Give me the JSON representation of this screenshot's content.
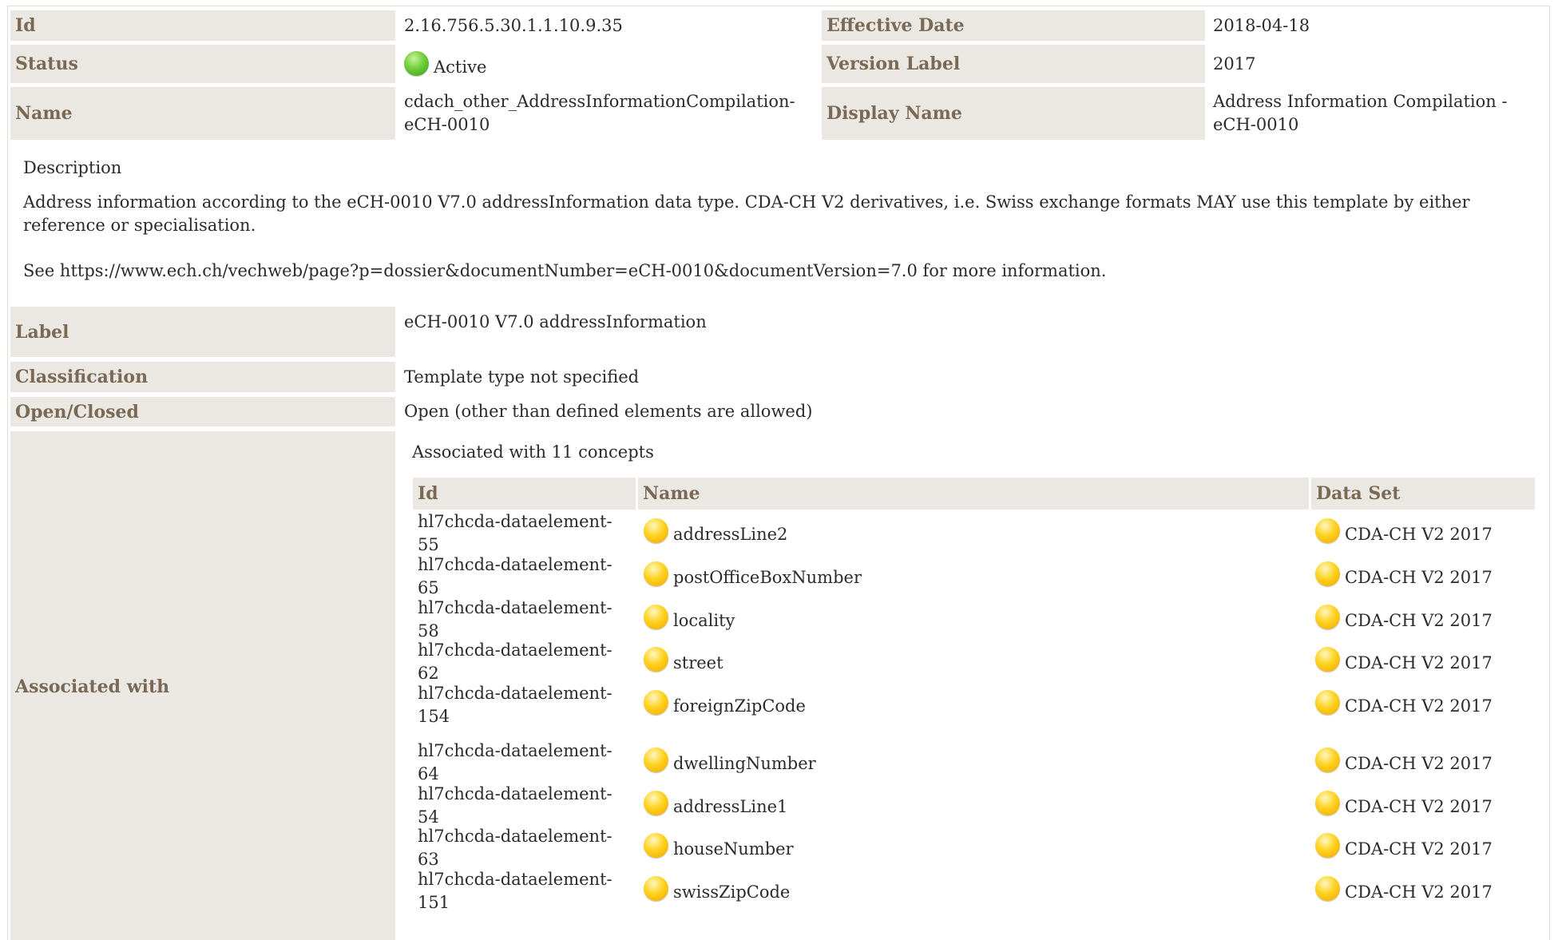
{
  "header": {
    "rows": [
      {
        "label": "Id",
        "value": "2.16.756.5.30.1.1.10.9.35",
        "label2": "Effective Date",
        "value2": "2018-04-18"
      },
      {
        "label": "Status",
        "value": "Active",
        "label2": "Version Label",
        "value2": "2017"
      },
      {
        "label": "Name",
        "value": "cdach_other_AddressInformationCompilation-eCH-0010",
        "label2": "Display Name",
        "value2": "Address Information Compilation - eCH-0010"
      }
    ],
    "status_icon": "green-ball-icon"
  },
  "description": {
    "heading": "Description",
    "paragraph1": "Address information according to the eCH-0010 V7.0 addressInformation data type. CDA-CH V2 derivatives, i.e. Swiss exchange formats MAY use this template by either reference or specialisation.",
    "paragraph2": "See https://www.ech.ch/vechweb/page?p=dossier&documentNumber=eCH-0010&documentVersion=7.0 for more information."
  },
  "properties": {
    "label_label": "Label",
    "label_value": "eCH-0010 V7.0 addressInformation",
    "classification_label": "Classification",
    "classification_value": "Template type not specified",
    "open_closed_label": "Open/Closed",
    "open_closed_value": "Open (other than defined elements are allowed)",
    "associated_label": "Associated with"
  },
  "associated": {
    "caption": "Associated with 11 concepts",
    "columns": [
      "Id",
      "Name",
      "Data Set"
    ],
    "concept_icon": "yellow-ball-icon",
    "rows": [
      {
        "id": "hl7chcda-dataelement-55",
        "name": "addressLine2",
        "dataset": "CDA-CH V2 2017"
      },
      {
        "id": "hl7chcda-dataelement-65",
        "name": "postOfficeBoxNumber",
        "dataset": "CDA-CH V2 2017"
      },
      {
        "id": "hl7chcda-dataelement-58",
        "name": "locality",
        "dataset": "CDA-CH V2 2017"
      },
      {
        "id": "hl7chcda-dataelement-62",
        "name": "street",
        "dataset": "CDA-CH V2 2017"
      },
      {
        "id": "hl7chcda-dataelement-154",
        "name": "foreignZipCode",
        "dataset": "CDA-CH V2 2017"
      },
      {
        "id": "hl7chcda-dataelement-64",
        "name": "dwellingNumber",
        "dataset": "CDA-CH V2 2017"
      },
      {
        "id": "hl7chcda-dataelement-54",
        "name": "addressLine1",
        "dataset": "CDA-CH V2 2017"
      },
      {
        "id": "hl7chcda-dataelement-63",
        "name": "houseNumber",
        "dataset": "CDA-CH V2 2017"
      },
      {
        "id": "hl7chcda-dataelement-151",
        "name": "swissZipCode",
        "dataset": "CDA-CH V2 2017"
      }
    ]
  }
}
